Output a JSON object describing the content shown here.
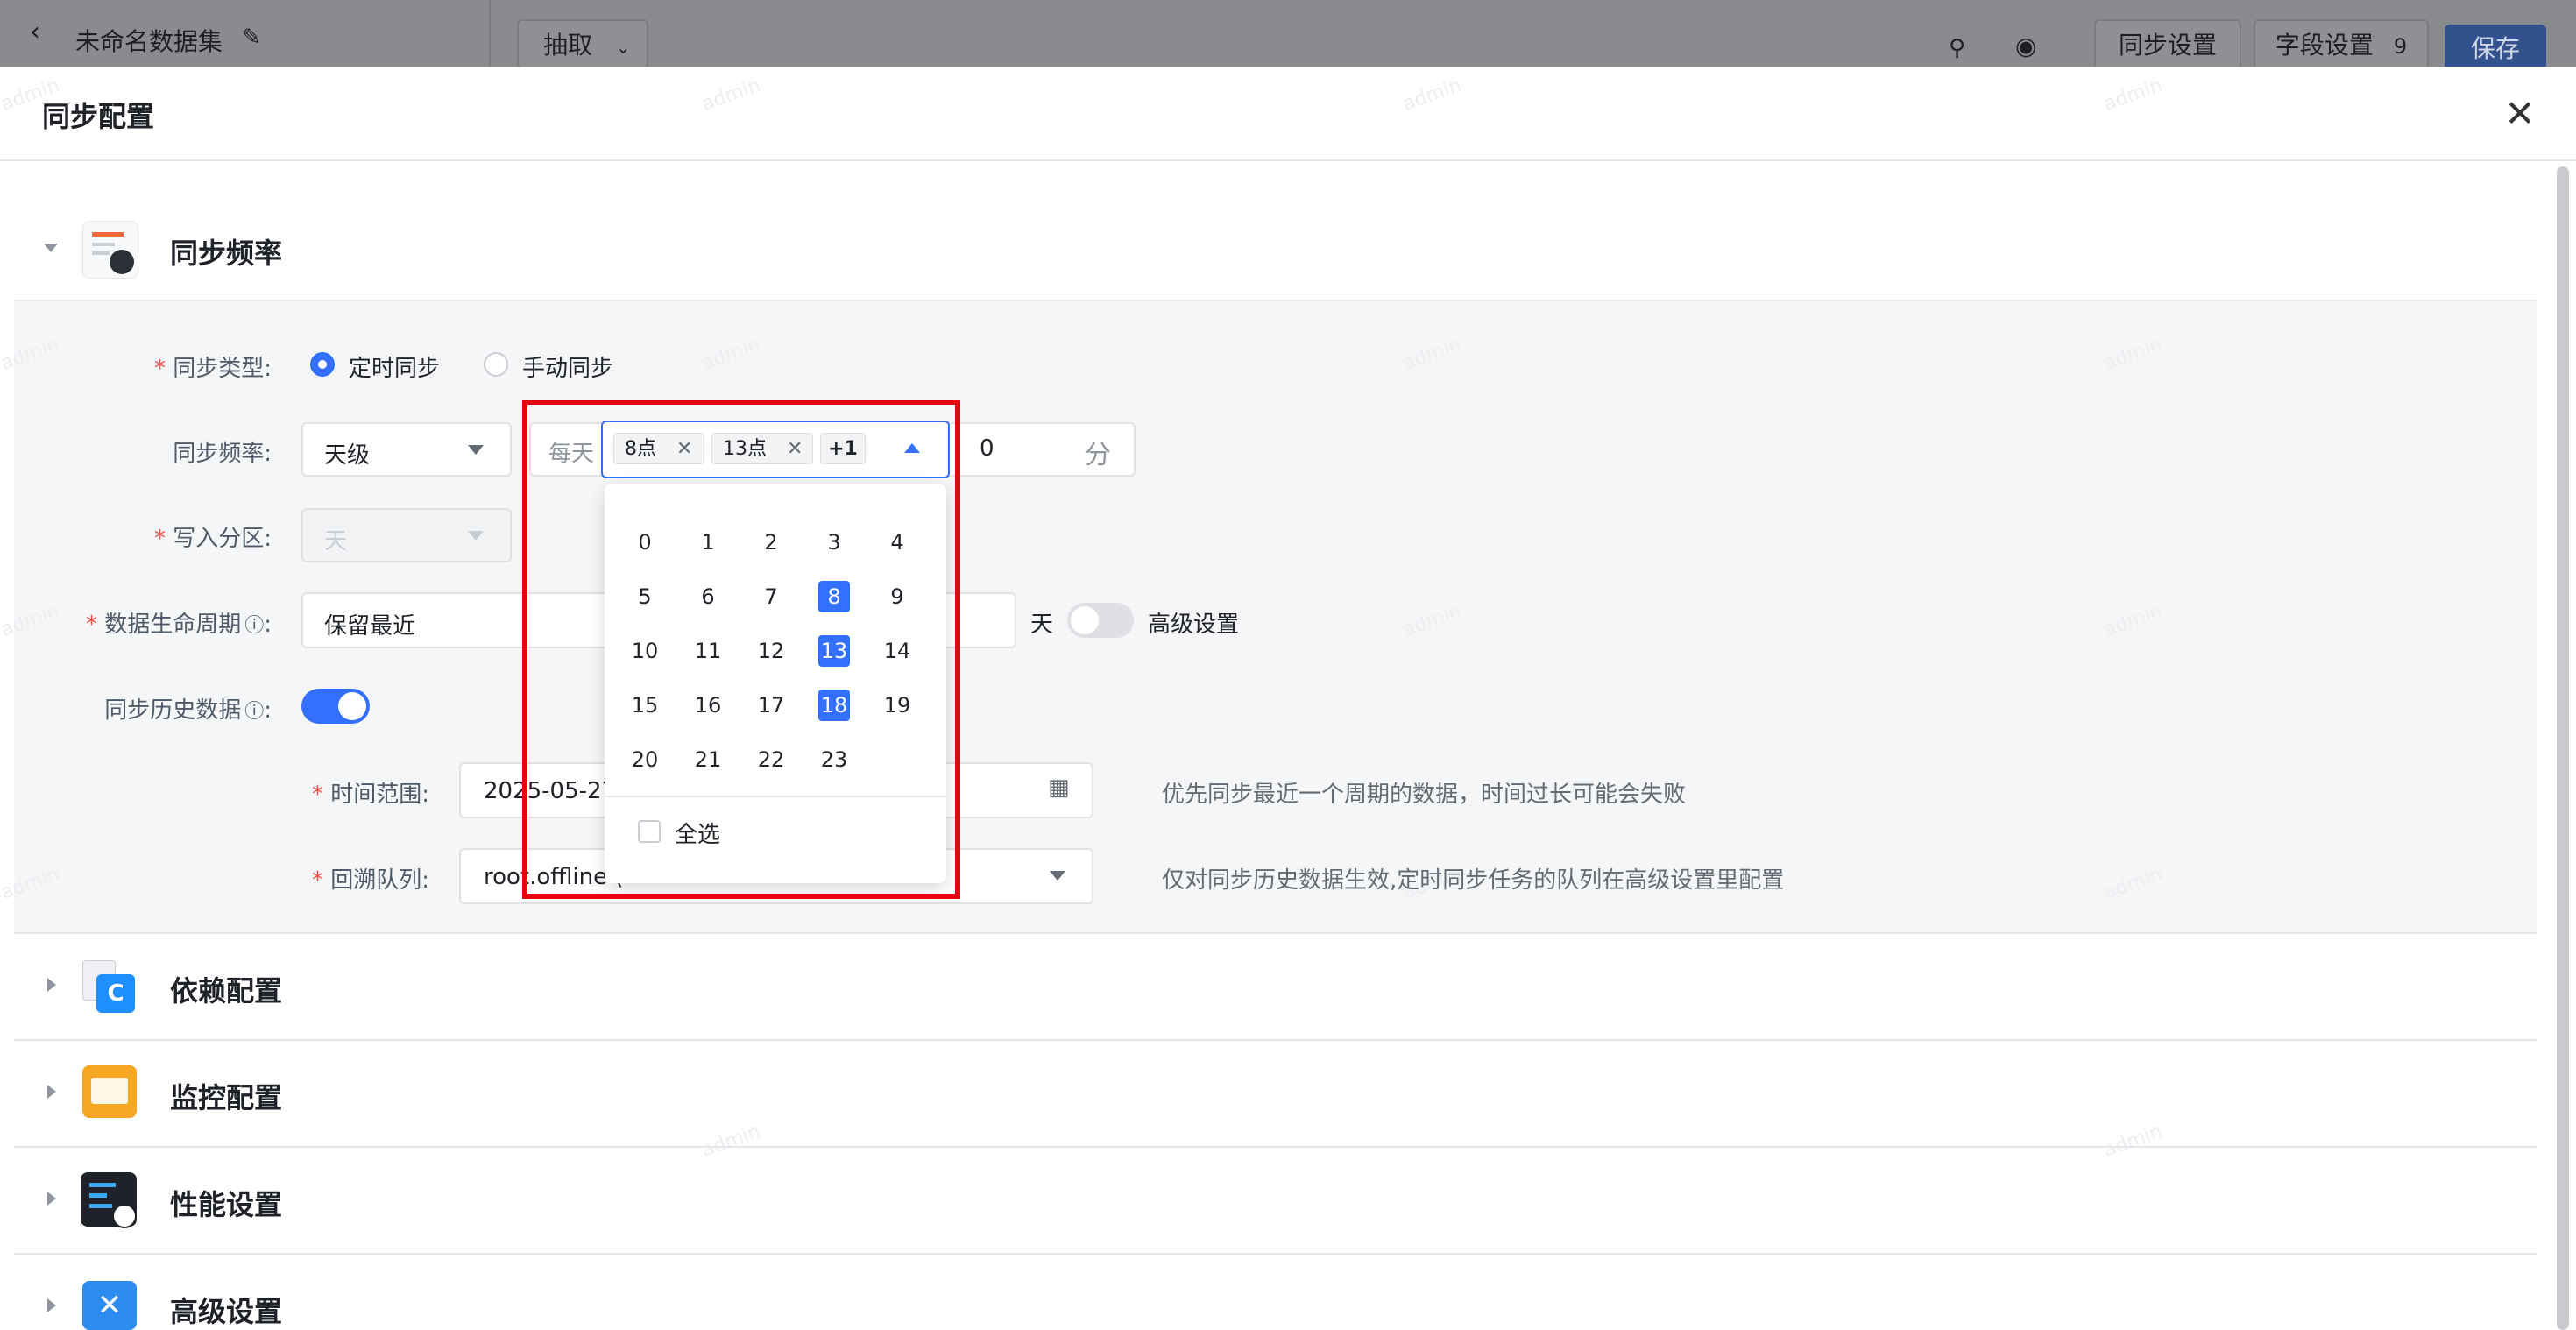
{
  "topbar": {
    "dataset_name": "未命名数据集",
    "mode_select": "抽取",
    "sync_settings_btn": "同步设置",
    "field_settings_btn": "字段设置",
    "field_count": "9",
    "save_btn": "保存"
  },
  "drawer": {
    "title": "同步配置"
  },
  "sections": {
    "freq": "同步频率",
    "dep": "依赖配置",
    "monitor": "监控配置",
    "perf": "性能设置",
    "adv": "高级设置"
  },
  "form": {
    "sync_type_label": "同步类型:",
    "sync_type_opt1": "定时同步",
    "sync_type_opt2": "手动同步",
    "sync_freq_label": "同步频率:",
    "sync_freq_value": "天级",
    "every_day": "每天",
    "tag1": "8点",
    "tag2": "13点",
    "tag_more": "+1",
    "minute_value": "0",
    "minute_unit": "分",
    "partition_label": "写入分区:",
    "partition_value": "天",
    "lifecycle_label": "数据生命周期",
    "lifecycle_value": "保留最近",
    "lifecycle_unit": "天",
    "advanced_label": "高级设置",
    "history_label": "同步历史数据",
    "time_range_label": "时间范围:",
    "time_range_value": "2025-05-27",
    "time_range_hint": "优先同步最近一个周期的数据，时间过长可能会失败",
    "queue_label": "回溯队列:",
    "queue_value": "root.offline (",
    "queue_hint": "仅对同步历史数据生效,定时同步任务的队列在高级设置里配置"
  },
  "hour_picker": {
    "hours": [
      "0",
      "1",
      "2",
      "3",
      "4",
      "5",
      "6",
      "7",
      "8",
      "9",
      "10",
      "11",
      "12",
      "13",
      "14",
      "15",
      "16",
      "17",
      "18",
      "19",
      "20",
      "21",
      "22",
      "23"
    ],
    "selected": [
      "8",
      "13",
      "18"
    ],
    "select_all": "全选"
  },
  "watermark": "admin",
  "colors": {
    "primary": "#3370ff",
    "highlight_box": "#e60012",
    "required": "#f54a45"
  }
}
